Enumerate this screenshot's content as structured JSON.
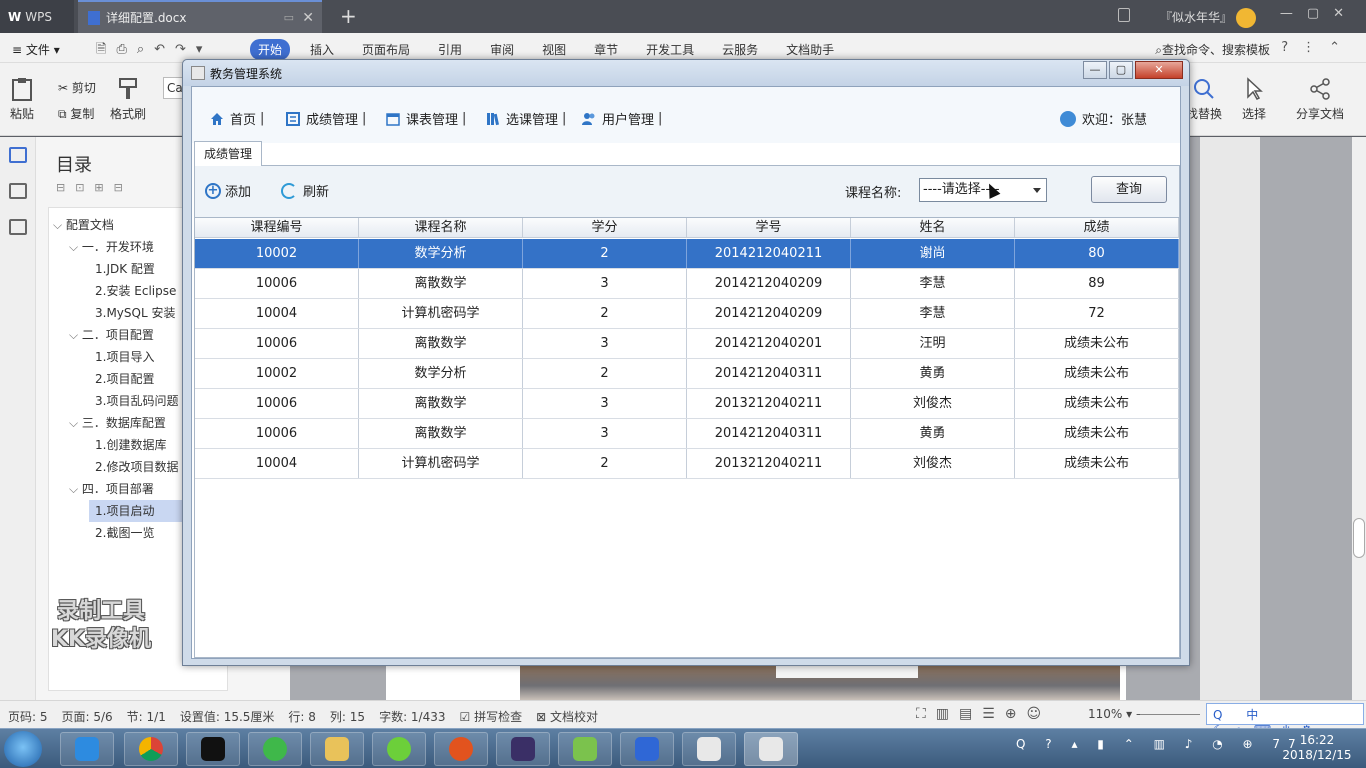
{
  "wps": {
    "app_name": "WPS",
    "doc_tab": "详细配置.docx",
    "user": "『似水年华』",
    "menu_file": "文件",
    "menu_tabs": [
      "开始",
      "插入",
      "页面布局",
      "引用",
      "审阅",
      "视图",
      "章节",
      "开发工具",
      "云服务",
      "文档助手"
    ],
    "menu_search": "查找命令、搜索模板",
    "ribbon": {
      "paste": "粘贴",
      "cut": "剪切",
      "copy": "复制",
      "format_painter": "格式刷",
      "font_box": "Ca",
      "find_replace": "找替换",
      "select": "选择",
      "share": "分享文档"
    },
    "toc": {
      "title": "目录",
      "items": [
        "配置文档",
        "一．开发环境",
        "1.JDK 配置",
        "2.安装 Eclipse",
        "3.MySQL 安装",
        "二．项目配置",
        "1.项目导入",
        "2.项目配置",
        "3.项目乱码问题",
        "三．数据库配置",
        "1.创建数据库",
        "2.修改项目数据",
        "四．项目部署",
        "1.项目启动",
        "2.截图一览"
      ]
    },
    "watermark": [
      "录制工具",
      "KK录像机"
    ],
    "status": [
      "页码: 5",
      "页面: 5/6",
      "节: 1/1",
      "设置值: 15.5厘米",
      "行: 8",
      "列: 15",
      "字数: 1/433",
      "拼写检查",
      "文档校对"
    ],
    "zoom": "110%",
    "ime": "中"
  },
  "taskbar": {
    "time": "16:22",
    "date": "2018/12/15",
    "badge": "77"
  },
  "dialog": {
    "title": "教务管理系统",
    "nav": [
      "首页",
      "成绩管理",
      "课表管理",
      "选课管理",
      "用户管理"
    ],
    "nav_sep": "|",
    "welcome": "欢迎：张慧",
    "tab": "成绩管理",
    "toolbar": {
      "add": "添加",
      "refresh": "刷新",
      "filter_label": "课程名称:",
      "filter_value": "----请选择----",
      "query": "查询"
    },
    "table": {
      "columns": [
        "课程编号",
        "课程名称",
        "学分",
        "学号",
        "姓名",
        "成绩"
      ],
      "rows": [
        [
          "10002",
          "数学分析",
          "2",
          "2014212040211",
          "谢尚",
          "80"
        ],
        [
          "10006",
          "离散数学",
          "3",
          "2014212040209",
          "李慧",
          "89"
        ],
        [
          "10004",
          "计算机密码学",
          "2",
          "2014212040209",
          "李慧",
          "72"
        ],
        [
          "10006",
          "离散数学",
          "3",
          "2014212040201",
          "汪明",
          "成绩未公布"
        ],
        [
          "10002",
          "数学分析",
          "2",
          "2014212040311",
          "黄勇",
          "成绩未公布"
        ],
        [
          "10006",
          "离散数学",
          "3",
          "2013212040211",
          "刘俊杰",
          "成绩未公布"
        ],
        [
          "10006",
          "离散数学",
          "3",
          "2014212040311",
          "黄勇",
          "成绩未公布"
        ],
        [
          "10004",
          "计算机密码学",
          "2",
          "2013212040211",
          "刘俊杰",
          "成绩未公布"
        ]
      ],
      "selected_row": 0
    }
  }
}
